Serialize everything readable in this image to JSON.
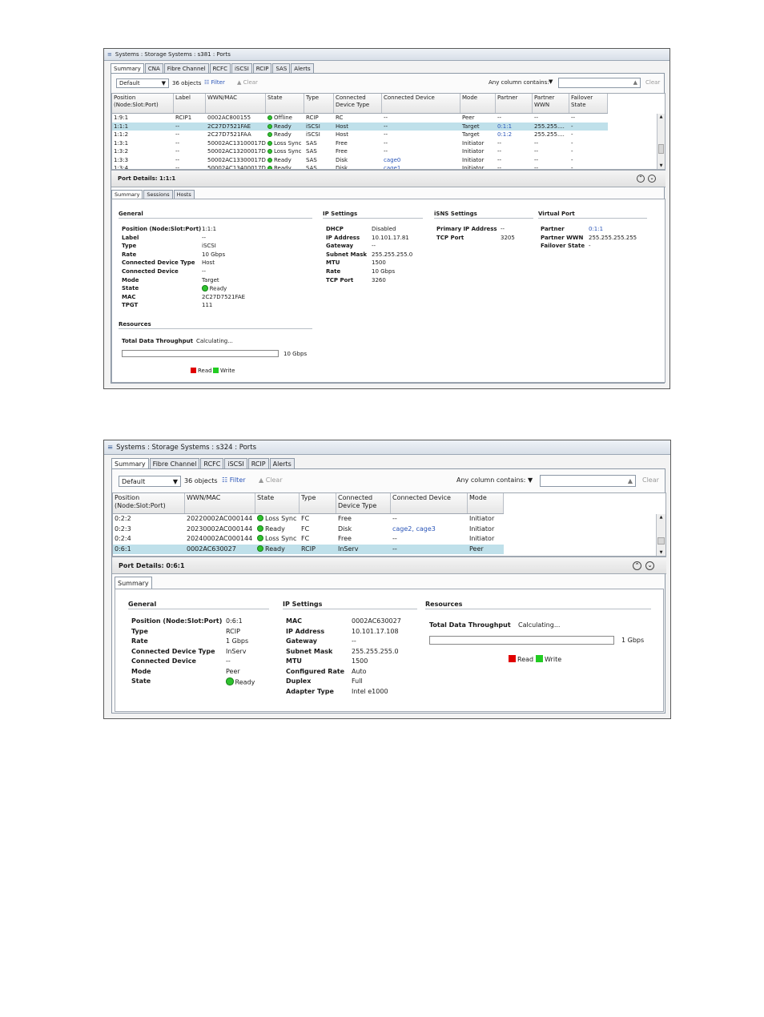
{
  "w1": {
    "title": "Systems : Storage Systems : s381 : Ports",
    "tabs": [
      "Summary",
      "CNA",
      "Fibre Channel",
      "RCFC",
      "iSCSI",
      "RCIP",
      "SAS",
      "Alerts"
    ],
    "view_select": "Default",
    "objects": "36 objects",
    "filter_label": "Filter",
    "clear_label": "Clear",
    "any_column": "Any column contains:",
    "search_clear": "Clear",
    "columns": [
      [
        "Position",
        "(Node:Slot:Port)"
      ],
      [
        "Label",
        ""
      ],
      [
        "WWN/MAC",
        ""
      ],
      [
        "State",
        ""
      ],
      [
        "Type",
        ""
      ],
      [
        "Connected",
        "Device Type"
      ],
      [
        "Connected Device",
        ""
      ],
      [
        "Mode",
        ""
      ],
      [
        "Partner",
        ""
      ],
      [
        "Partner",
        "WWN"
      ],
      [
        "Failover",
        "State"
      ]
    ],
    "rows": [
      [
        "1:9:1",
        "RCIP1",
        "0002AC800155",
        "Offline",
        "RCIP",
        "RC",
        "--",
        "Peer",
        "--",
        "--",
        "--"
      ],
      [
        "1:1:1",
        "--",
        "2C27D7521FAE",
        "Ready",
        "iSCSI",
        "Host",
        "--",
        "Target",
        "0:1:1",
        "255.255....",
        "-"
      ],
      [
        "1:1:2",
        "--",
        "2C27D7521FAA",
        "Ready",
        "iSCSI",
        "Host",
        "--",
        "Target",
        "0:1:2",
        "255.255....",
        "-"
      ],
      [
        "1:3:1",
        "--",
        "50002AC13100017D",
        "Loss Sync",
        "SAS",
        "Free",
        "--",
        "Initiator",
        "--",
        "--",
        "-"
      ],
      [
        "1:3:2",
        "--",
        "50002AC13200017D",
        "Loss Sync",
        "SAS",
        "Free",
        "--",
        "Initiator",
        "--",
        "--",
        "-"
      ],
      [
        "1:3:3",
        "--",
        "50002AC13300017D",
        "Ready",
        "SAS",
        "Disk",
        "cage0",
        "Initiator",
        "--",
        "--",
        "-"
      ],
      [
        "1:3:4",
        "--",
        "50002AC13400017D",
        "Ready",
        "SAS",
        "Disk",
        "cage1",
        "Initiator",
        "--",
        "--",
        "-"
      ]
    ],
    "details_title": "Port Details: 1:1:1",
    "detail_tabs": [
      "Summary",
      "Sessions",
      "Hosts"
    ],
    "general": {
      "title": "General",
      "items": [
        [
          "Position (Node:Slot:Port)",
          "1:1:1"
        ],
        [
          "Label",
          "--"
        ],
        [
          "Type",
          "iSCSI"
        ],
        [
          "Rate",
          "10 Gbps"
        ],
        [
          "Connected Device Type",
          "Host"
        ],
        [
          "Connected Device",
          "--"
        ],
        [
          "Mode",
          "Target"
        ],
        [
          "State",
          "Ready"
        ],
        [
          "MAC",
          "2C27D7521FAE"
        ],
        [
          "TPGT",
          "111"
        ]
      ]
    },
    "ip": {
      "title": "IP Settings",
      "items": [
        [
          "DHCP",
          "Disabled"
        ],
        [
          "IP Address",
          "10.101.17.81"
        ],
        [
          "Gateway",
          "--"
        ],
        [
          "Subnet Mask",
          "255.255.255.0"
        ],
        [
          "MTU",
          "1500"
        ],
        [
          "Rate",
          "10 Gbps"
        ],
        [
          "TCP Port",
          "3260"
        ]
      ]
    },
    "isns": {
      "title": "iSNS Settings",
      "items": [
        [
          "Primary IP Address",
          "--"
        ],
        [
          "TCP Port",
          "3205"
        ]
      ]
    },
    "vport": {
      "title": "Virtual Port",
      "items": [
        [
          "Partner",
          "0:1:1"
        ],
        [
          "Partner WWN",
          "255.255.255.255"
        ],
        [
          "Failover State",
          "-"
        ]
      ]
    },
    "resources": {
      "title": "Resources",
      "throughput_label": "Total Data Throughput",
      "throughput_value": "Calculating...",
      "max": "10 Gbps",
      "read": "Read",
      "write": "Write"
    }
  },
  "w2": {
    "title": "Systems : Storage Systems : s324 : Ports",
    "tabs": [
      "Summary",
      "Fibre Channel",
      "RCFC",
      "iSCSI",
      "RCIP",
      "Alerts"
    ],
    "view_select": "Default",
    "objects": "36 objects",
    "filter_label": "Filter",
    "clear_label": "Clear",
    "any_column": "Any column contains:",
    "search_clear": "Clear",
    "columns": [
      [
        "Position",
        "(Node:Slot:Port)"
      ],
      [
        "WWN/MAC",
        ""
      ],
      [
        "State",
        ""
      ],
      [
        "Type",
        ""
      ],
      [
        "Connected",
        "Device Type"
      ],
      [
        "Connected Device",
        ""
      ],
      [
        "Mode",
        ""
      ]
    ],
    "rows": [
      [
        "0:2:2",
        "20220002AC000144",
        "Loss Sync",
        "FC",
        "Free",
        "--",
        "Initiator"
      ],
      [
        "0:2:3",
        "20230002AC000144",
        "Ready",
        "FC",
        "Disk",
        "cage2, cage3",
        "Initiator"
      ],
      [
        "0:2:4",
        "20240002AC000144",
        "Loss Sync",
        "FC",
        "Free",
        "--",
        "Initiator"
      ],
      [
        "0:6:1",
        "0002AC630027",
        "Ready",
        "RCIP",
        "InServ",
        "--",
        "Peer"
      ]
    ],
    "details_title": "Port Details: 0:6:1",
    "detail_tabs": [
      "Summary"
    ],
    "general": {
      "title": "General",
      "items": [
        [
          "Position (Node:Slot:Port)",
          "0:6:1"
        ],
        [
          "Type",
          "RCIP"
        ],
        [
          "Rate",
          "1 Gbps"
        ],
        [
          "Connected Device Type",
          "InServ"
        ],
        [
          "Connected Device",
          "--"
        ],
        [
          "Mode",
          "Peer"
        ],
        [
          "State",
          "Ready"
        ]
      ]
    },
    "ip": {
      "title": "IP Settings",
      "items": [
        [
          "MAC",
          "0002AC630027"
        ],
        [
          "IP Address",
          "10.101.17.108"
        ],
        [
          "Gateway",
          "--"
        ],
        [
          "Subnet Mask",
          "255.255.255.0"
        ],
        [
          "MTU",
          "1500"
        ],
        [
          "Configured Rate",
          "Auto"
        ],
        [
          "Duplex",
          "Full"
        ],
        [
          "Adapter Type",
          "Intel e1000"
        ]
      ]
    },
    "resources": {
      "title": "Resources",
      "throughput_label": "Total Data Throughput",
      "throughput_value": "Calculating...",
      "max": "1 Gbps",
      "read": "Read",
      "write": "Write"
    }
  },
  "colors": {
    "ready": "#2ec22e",
    "link": "#2a55b8",
    "selected_row": "#bfe0ea",
    "read": "#e00000",
    "write": "#22cc22"
  }
}
